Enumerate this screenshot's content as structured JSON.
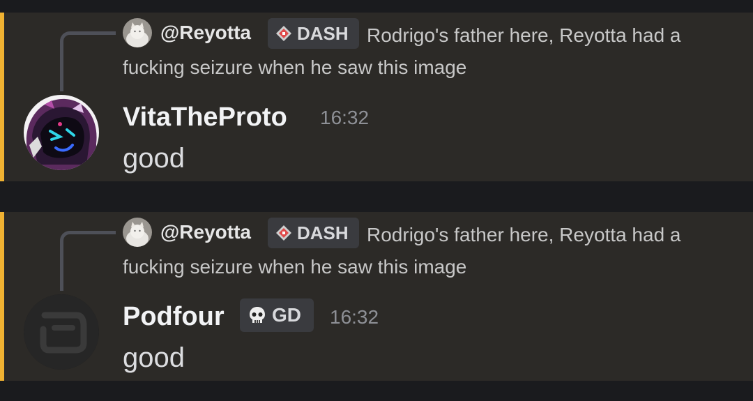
{
  "messages": [
    {
      "reply": {
        "username": "@Reyotta",
        "tag": "DASH",
        "text": "Rodrigo's father here, Reyotta had a fucking seizure when he saw this image"
      },
      "author": "VitaTheProto",
      "author_tag": "",
      "timestamp": "16:32",
      "content": "good"
    },
    {
      "reply": {
        "username": "@Reyotta",
        "tag": "DASH",
        "text": "Rodrigo's father here, Reyotta had a fucking seizure when he saw this image"
      },
      "author": "Podfour",
      "author_tag": "GD",
      "timestamp": "16:32",
      "content": "good"
    }
  ],
  "colors": {
    "highlight_bar": "#f0b232",
    "message_bg": "#2c2a27",
    "page_bg": "#1a1b1e"
  },
  "icons": {
    "reply_avatar": "cat-avatar-icon",
    "dash_tag": "dash-diamond-icon",
    "gd_tag": "skull-icon"
  }
}
